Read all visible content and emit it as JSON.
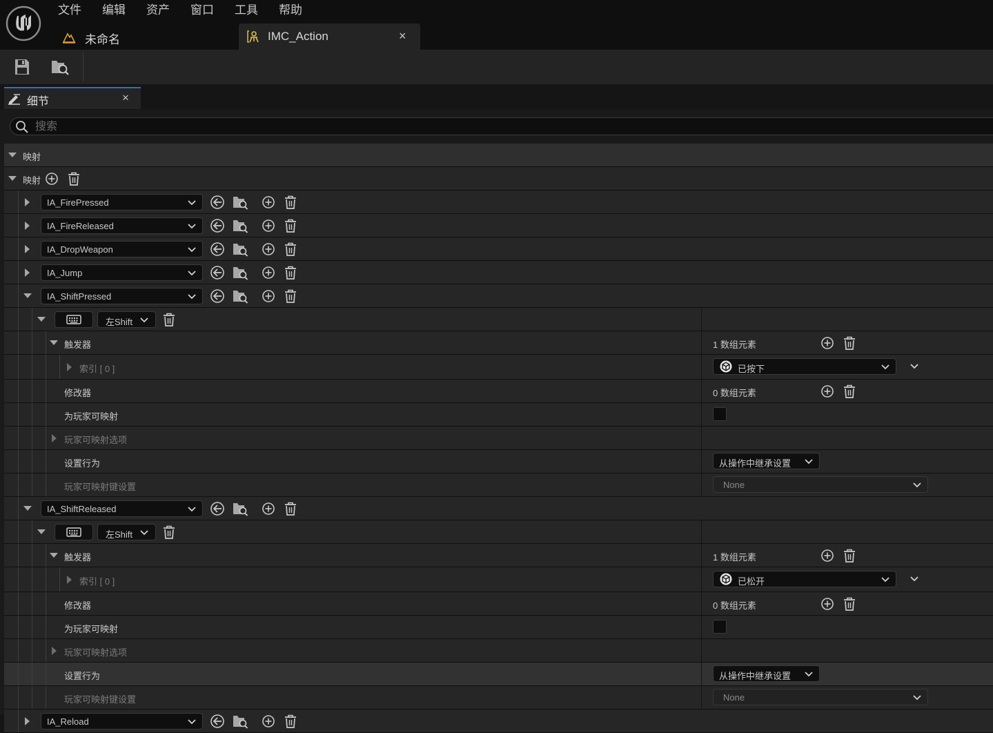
{
  "menu": {
    "items": [
      "文件",
      "编辑",
      "资产",
      "窗口",
      "工具",
      "帮助"
    ]
  },
  "tabs": {
    "level_tab_label": "未命名",
    "asset_tab_label": "IMC_Action",
    "close_glyph": "×"
  },
  "toolbar": {
    "icons": [
      "save-icon",
      "browse-to-asset-icon"
    ]
  },
  "details": {
    "tab_label": "细节",
    "close_glyph": "×",
    "search_placeholder": "搜索",
    "category_label": "映射",
    "mappings_label": "映射"
  },
  "actions": [
    {
      "name": "IA_FirePressed",
      "expanded": false
    },
    {
      "name": "IA_FireReleased",
      "expanded": false
    },
    {
      "name": "IA_DropWeapon",
      "expanded": false
    },
    {
      "name": "IA_Jump",
      "expanded": false
    },
    {
      "name": "IA_ShiftPressed",
      "expanded": true
    },
    {
      "name": "IA_ShiftReleased",
      "expanded": true
    },
    {
      "name": "IA_Reload",
      "expanded": false
    }
  ],
  "mapping_blocks": [
    {
      "key": "左Shift",
      "triggers_label": "触发器",
      "triggers_count": "1 数组元素",
      "index_label": "索引 [ 0 ]",
      "trigger_value": "已按下",
      "modifiers_label": "修改器",
      "modifiers_count": "0 数组元素",
      "player_mappable_label": "为玩家可映射",
      "player_mappable_checked": false,
      "player_options_label": "玩家可映射选项",
      "setting_behavior_label": "设置行为",
      "setting_behavior_value": "从操作中继承设置",
      "key_settings_label": "玩家可映射键设置",
      "key_settings_value": "None"
    },
    {
      "key": "左Shift",
      "triggers_label": "触发器",
      "triggers_count": "1 数组元素",
      "index_label": "索引 [ 0 ]",
      "trigger_value": "已松开",
      "modifiers_label": "修改器",
      "modifiers_count": "0 数组元素",
      "player_mappable_label": "为玩家可映射",
      "player_mappable_checked": false,
      "player_options_label": "玩家可映射选项",
      "setting_behavior_label": "设置行为",
      "setting_behavior_value": "从操作中继承设置",
      "key_settings_label": "玩家可映射键设置",
      "key_settings_value": "None"
    }
  ],
  "colors": {
    "background": "#151515",
    "row": "#262626",
    "accent": "#2a70c8"
  }
}
